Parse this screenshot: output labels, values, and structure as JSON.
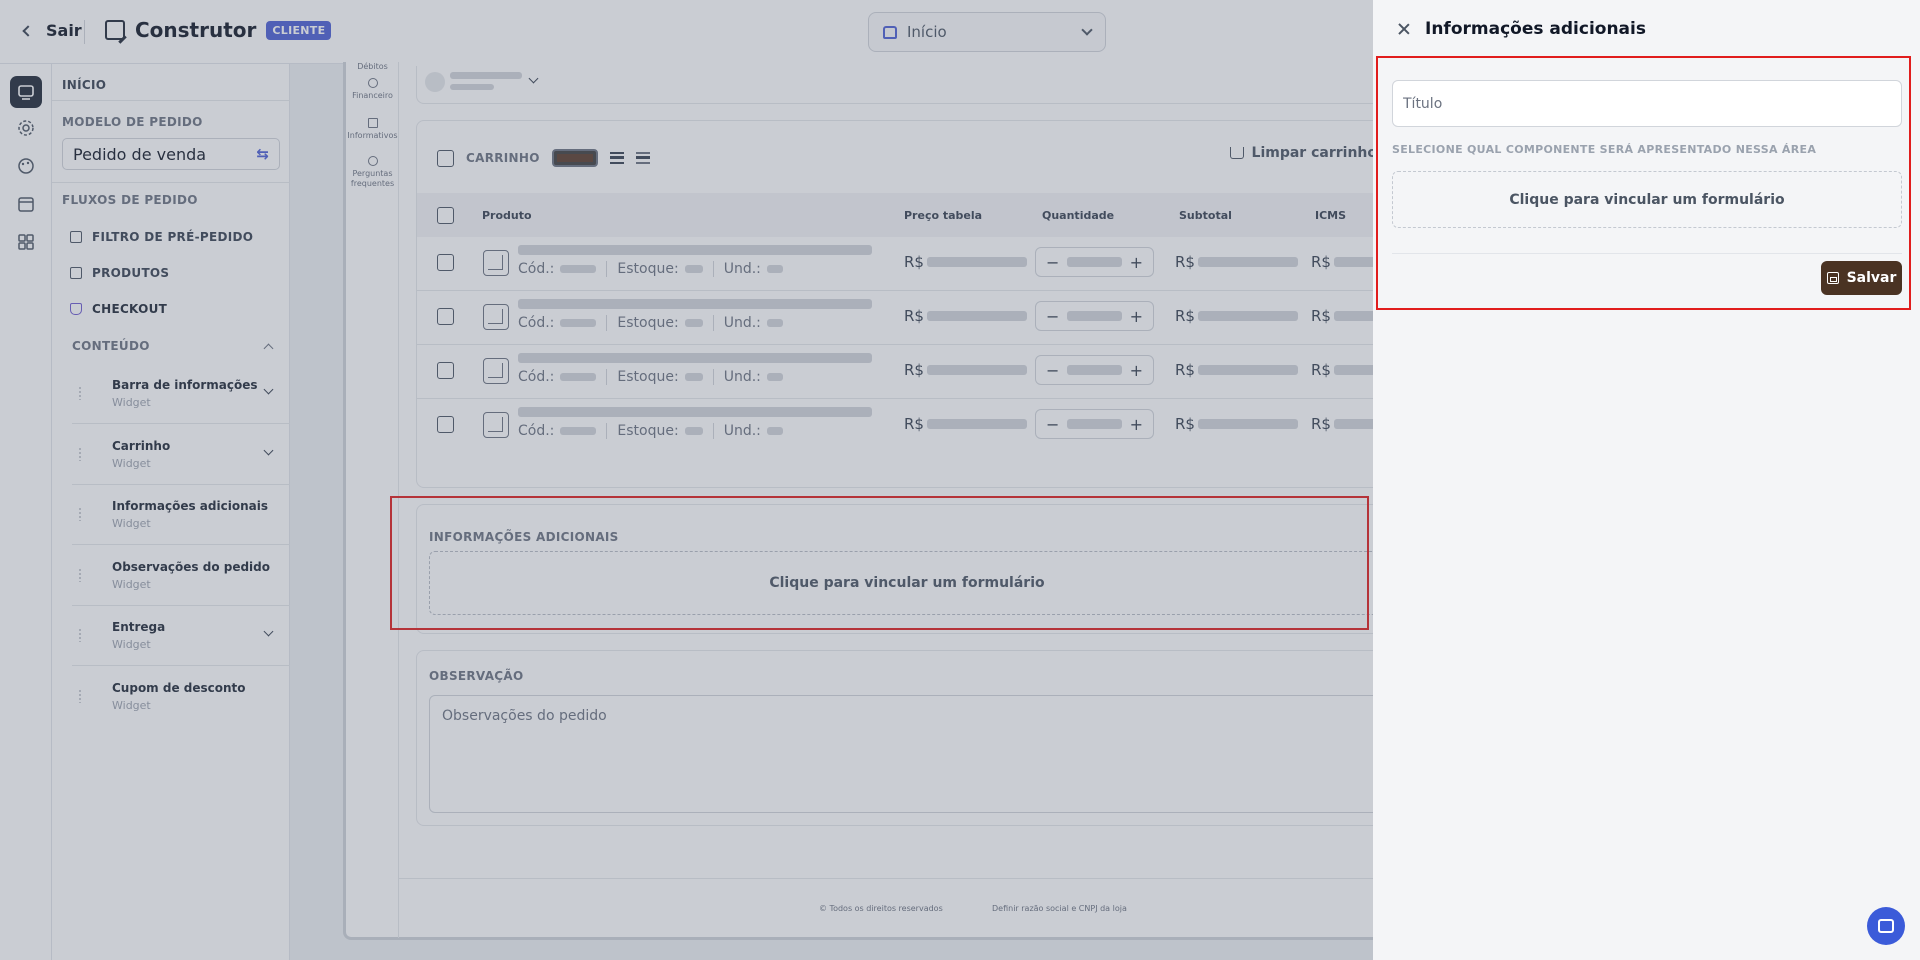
{
  "topbar": {
    "back_label": "Sair",
    "title": "Construtor",
    "badge": "CLIENTE",
    "page_select": "Início"
  },
  "nav": {
    "inicio": "INÍCIO",
    "order_model_heading": "MODELO DE PEDIDO",
    "order_model_value": "Pedido de venda",
    "flows_heading": "FLUXOS DE PEDIDO",
    "flows": [
      "FILTRO DE PRÉ-PEDIDO",
      "PRODUTOS",
      "CHECKOUT"
    ],
    "content_heading": "CONTEÚDO",
    "widgets": [
      {
        "name": "Barra de informações",
        "type": "Widget",
        "expandable": true
      },
      {
        "name": "Carrinho",
        "type": "Widget",
        "expandable": true
      },
      {
        "name": "Informações adicionais",
        "type": "Widget",
        "expandable": false
      },
      {
        "name": "Observações do pedido",
        "type": "Widget",
        "expandable": false
      },
      {
        "name": "Entrega",
        "type": "Widget",
        "expandable": true
      },
      {
        "name": "Cupom de desconto",
        "type": "Widget",
        "expandable": false
      }
    ]
  },
  "preview": {
    "mini_nav": [
      "Débitos",
      "Financeiro",
      "Informativos",
      "Perguntas frequentes"
    ],
    "cart": {
      "label": "CARRINHO",
      "clear_label": "Limpar carrinho",
      "columns": [
        "Produto",
        "Preço tabela",
        "Quantidade",
        "Subtotal",
        "ICMS"
      ],
      "row_labels": {
        "code": "Cód.:",
        "stock": "Estoque:",
        "unit": "Und.:",
        "currency": "R$"
      },
      "rows": 4
    },
    "additional_info": {
      "label": "INFORMAÇÕES ADICIONAIS",
      "link_form": "Clique para vincular um formulário"
    },
    "observation": {
      "label": "OBSERVAÇÃO",
      "placeholder": "Observações do pedido"
    },
    "footer": {
      "rights": "© Todos os direitos reservados",
      "company": "Definir razão social e CNPJ da loja"
    }
  },
  "panel": {
    "title": "Informações adicionais",
    "title_placeholder": "Título",
    "select_label": "SELECIONE QUAL COMPONENTE SERÁ APRESENTADO NESSA ÁREA",
    "link_form": "Clique para vincular um formulário",
    "save_label": "Salvar"
  },
  "colors": {
    "accent": "#4c5fd5",
    "save_button": "#4a3323",
    "highlight": "#e11d1d"
  }
}
